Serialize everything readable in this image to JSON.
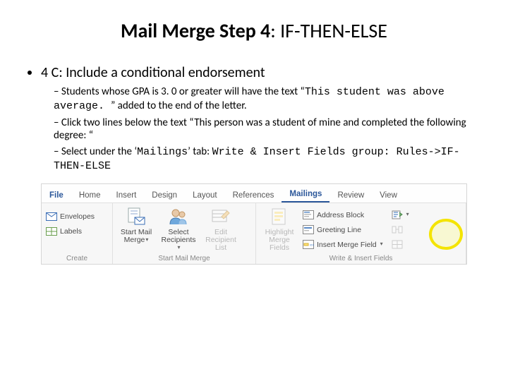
{
  "title": {
    "bold": "Mail Merge Step 4",
    "rest": ": IF-THEN-ELSE"
  },
  "bullet": {
    "main": "4 C: Include a conditional endorsement",
    "sub1a": "Students whose GPA is 3. 0 or greater will have the text “",
    "sub1b": "This student was above average. ",
    "sub1c": "” added to the end of the letter.",
    "sub2": "Click two lines below the text “This person was a student of mine and completed the following degree: “",
    "sub3a": "Select under the ‘",
    "sub3b": "Mailings",
    "sub3c": "’ tab: ",
    "sub3d": "Write & Insert Fields group: Rules->IF-THEN-ELSE"
  },
  "tabs": {
    "file": "File",
    "home": "Home",
    "insert": "Insert",
    "design": "Design",
    "layout": "Layout",
    "references": "References",
    "mailings": "Mailings",
    "review": "Review",
    "view": "View"
  },
  "ribbon": {
    "create": {
      "label": "Create",
      "envelopes": "Envelopes",
      "labels": "Labels"
    },
    "startmm": {
      "label": "Start Mail Merge",
      "start": "Start Mail\nMerge",
      "select": "Select\nRecipients",
      "edit": "Edit\nRecipient List"
    },
    "write": {
      "label": "Write & Insert Fields",
      "highlight": "Highlight\nMerge Fields",
      "addr": "Address Block",
      "greet": "Greeting Line",
      "insert": "Insert Merge Field"
    }
  }
}
